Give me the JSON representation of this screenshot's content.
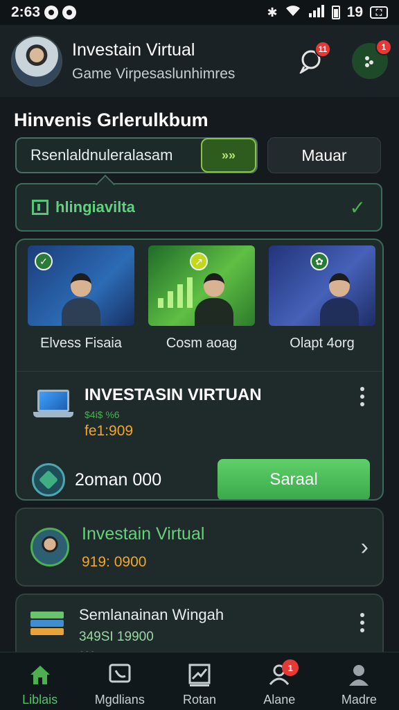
{
  "status_bar": {
    "time": "2:63",
    "right_text": "19"
  },
  "header": {
    "title": "Investain Virtual",
    "subtitle": "Game Virpesaslunhimres",
    "notification_count": "11",
    "menu_badge": "1"
  },
  "section": {
    "title": "Hinvenis Grlerulkbum"
  },
  "tabs": {
    "primary_label": "Rsenlaldnuleralasam",
    "primary_chip": "»»",
    "secondary_label": "Mauar"
  },
  "dropdown": {
    "label": "hlingiavilta"
  },
  "thumbnails": [
    {
      "label": "Elvess Fisaia"
    },
    {
      "label": "Cosm aoag"
    },
    {
      "label": "Olapt 4org"
    }
  ],
  "product": {
    "title": "INVESTASIN VIRTUAN",
    "tag": "$4i$ %6",
    "price": "fe1:909"
  },
  "action": {
    "amount": "2oman 000",
    "button_label": "Saraal"
  },
  "list": [
    {
      "title": "Investain Virtual",
      "price": "919: 0900"
    },
    {
      "title": "Semlanainan Wingah",
      "price": "349SI 19900",
      "sub_price": "ooo"
    }
  ],
  "bottom_nav": [
    {
      "label": "Liblais",
      "icon": "home-icon",
      "active": true
    },
    {
      "label": "Mgdlians",
      "icon": "chat-icon",
      "active": false
    },
    {
      "label": "Rotan",
      "icon": "chart-icon",
      "active": false
    },
    {
      "label": "Alane",
      "icon": "user-group-icon",
      "active": false,
      "badge": "1"
    },
    {
      "label": "Madre",
      "icon": "profile-icon",
      "active": false
    }
  ],
  "colors": {
    "accent_green": "#4caf50",
    "price_orange": "#f5a623",
    "background": "#141a1d"
  }
}
